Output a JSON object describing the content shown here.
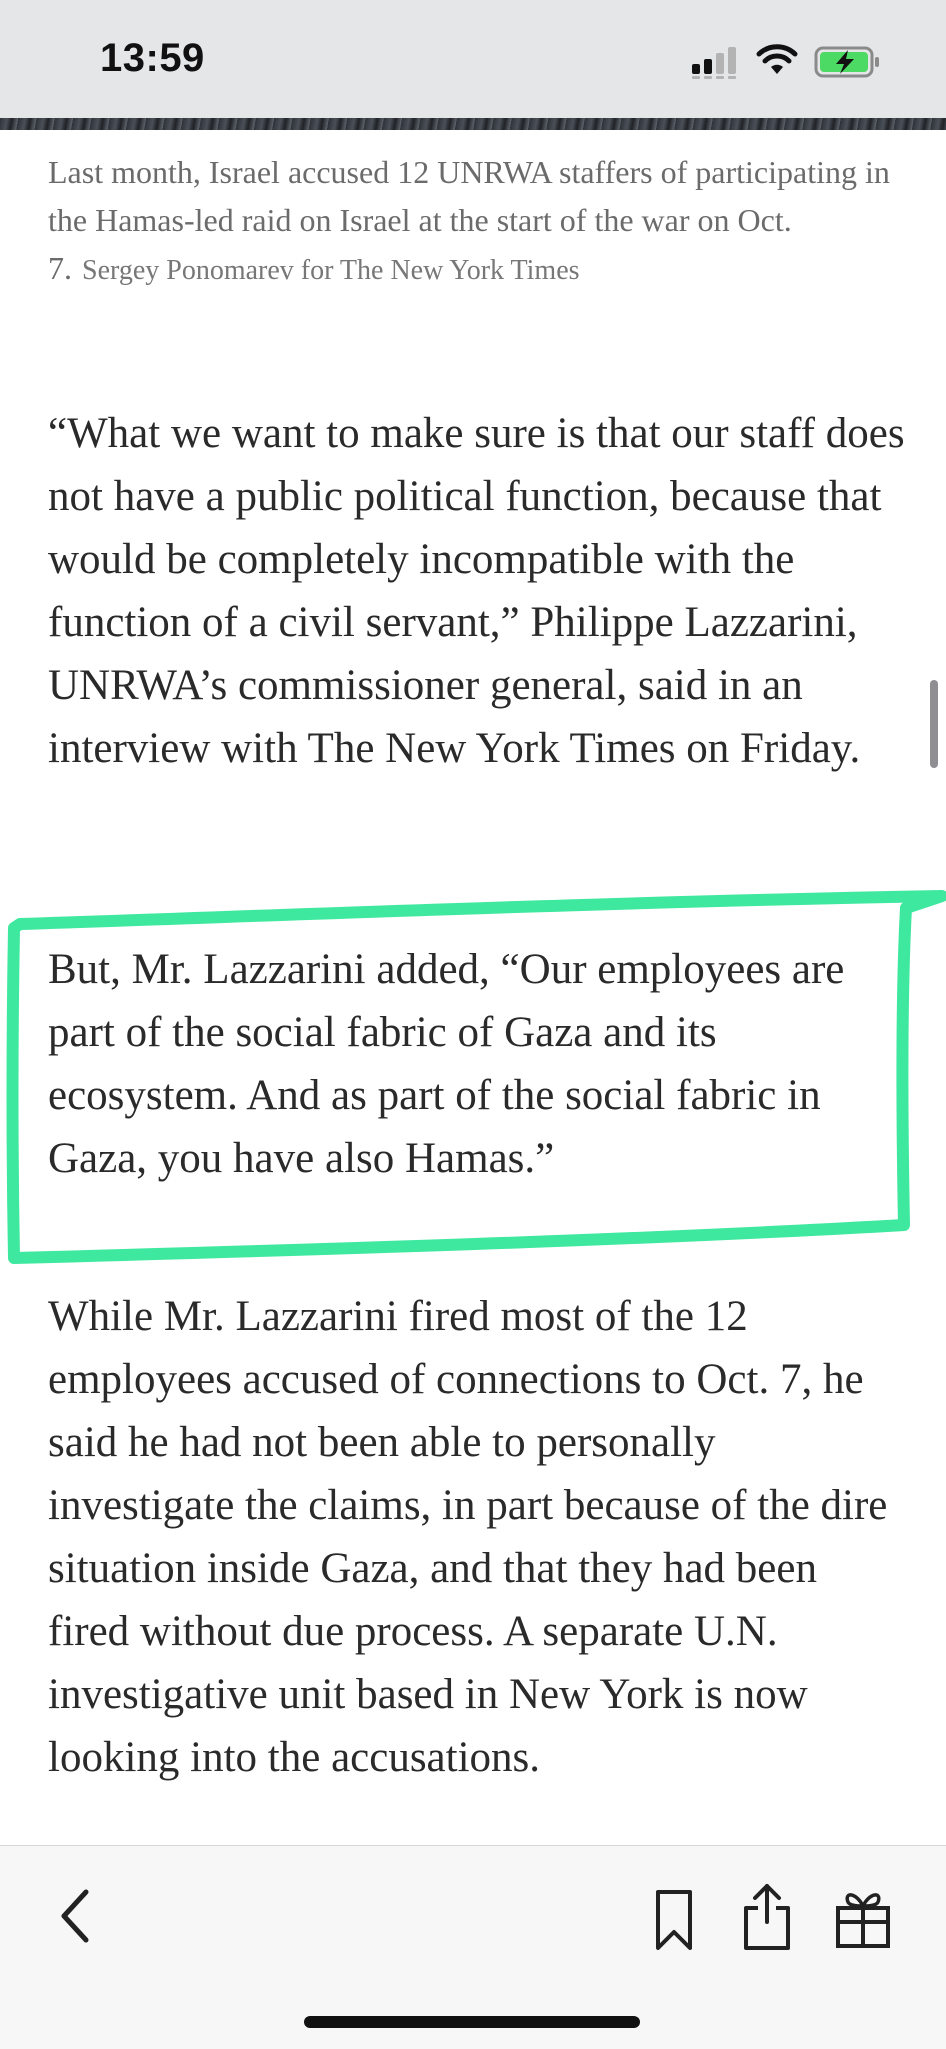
{
  "status_bar": {
    "time": "13:59",
    "icons": [
      "signal-icon",
      "wifi-icon",
      "battery-charging-icon"
    ]
  },
  "caption": {
    "text": "Last month, Israel accused 12 UNRWA staffers of participating in the Hamas-led raid on Israel at the start of the war on Oct. 7.",
    "credit": "Sergey Ponomarev for The New York Times"
  },
  "article": {
    "paragraphs": [
      "“What we want to make sure is that our staff does not have a public political function, because that would be completely incompatible with the function of a civil servant,” Philippe Lazzarini, UNRWA’s commissioner general, said in an interview with The New York Times on Friday.",
      "But, Mr. Lazzarini added, “Our employees are part of the social fabric of Gaza and its ecosystem. And as part of the social fabric in Gaza, you have also Hamas.”",
      "While Mr. Lazzarini fired most of the 12 employees accused of connections to Oct. 7, he said he had not been able to personally investigate the claims, in part because of the dire situation inside Gaza, and that they had been fired without due process. A separate U.N. investigative unit based in New York is now looking into the accusations."
    ]
  },
  "annotation": {
    "color": "#3ee89f"
  },
  "toolbar": {
    "icons": [
      "back-chevron-icon",
      "bookmark-icon",
      "share-icon",
      "gift-icon"
    ]
  },
  "colors": {
    "text": "#2a2a2a",
    "caption": "#6b6b6b",
    "toolbar_bg": "#f7f7f7"
  }
}
